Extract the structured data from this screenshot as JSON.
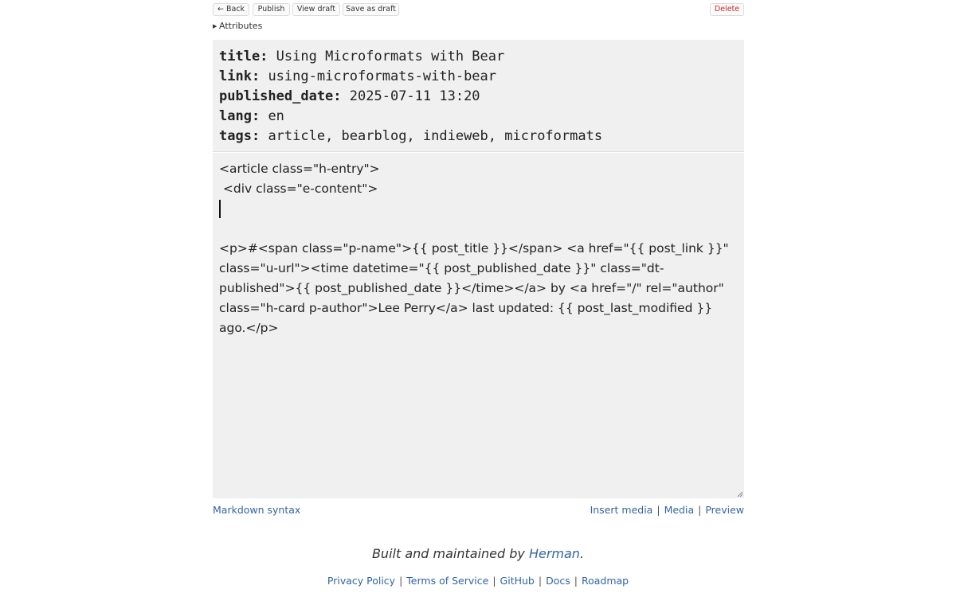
{
  "toolbar": {
    "back": "← Back",
    "publish": "Publish",
    "view_draft": "View draft",
    "save_draft": "Save as draft",
    "delete": "Delete"
  },
  "attributes_toggle": {
    "icon": "triangle-right-icon",
    "label": "Attributes"
  },
  "attributes": [
    {
      "key": "title:",
      "value": "Using Microformats with Bear"
    },
    {
      "key": "link:",
      "value": "using-microformats-with-bear"
    },
    {
      "key": "published_date:",
      "value": "2025-07-11 13:20"
    },
    {
      "key": "lang:",
      "value": "en"
    },
    {
      "key": "tags:",
      "value": "article, bearblog, indieweb, microformats"
    }
  ],
  "editor": {
    "line1": "<article class=\"h-entry\">",
    "line2": " <div class=\"e-content\">",
    "paragraph": "<p>#<span class=\"p-name\">{{ post_title }}</span> <a href=\"{{ post_link }}\" class=\"u-url\"><time datetime=\"{{ post_published_date }}\" class=\"dt-published\">{{ post_published_date }}</time></a> by <a href=\"/\" rel=\"author\" class=\"h-card p-author\">Lee Perry</a> last updated: {{ post_last_modified }} ago.</p>"
  },
  "subbar": {
    "markdown_syntax": "Markdown syntax",
    "insert_media": "Insert media",
    "media": "Media",
    "preview": "Preview"
  },
  "footer": {
    "built_prefix": "Built and maintained by ",
    "built_author": "Herman",
    "built_suffix": ".",
    "links": [
      "Privacy Policy",
      "Terms of Service",
      "GitHub",
      "Docs",
      "Roadmap"
    ]
  },
  "colors": {
    "link": "#3465a4",
    "delete": "#c62828",
    "editor_bg": "#f0f0f0"
  }
}
